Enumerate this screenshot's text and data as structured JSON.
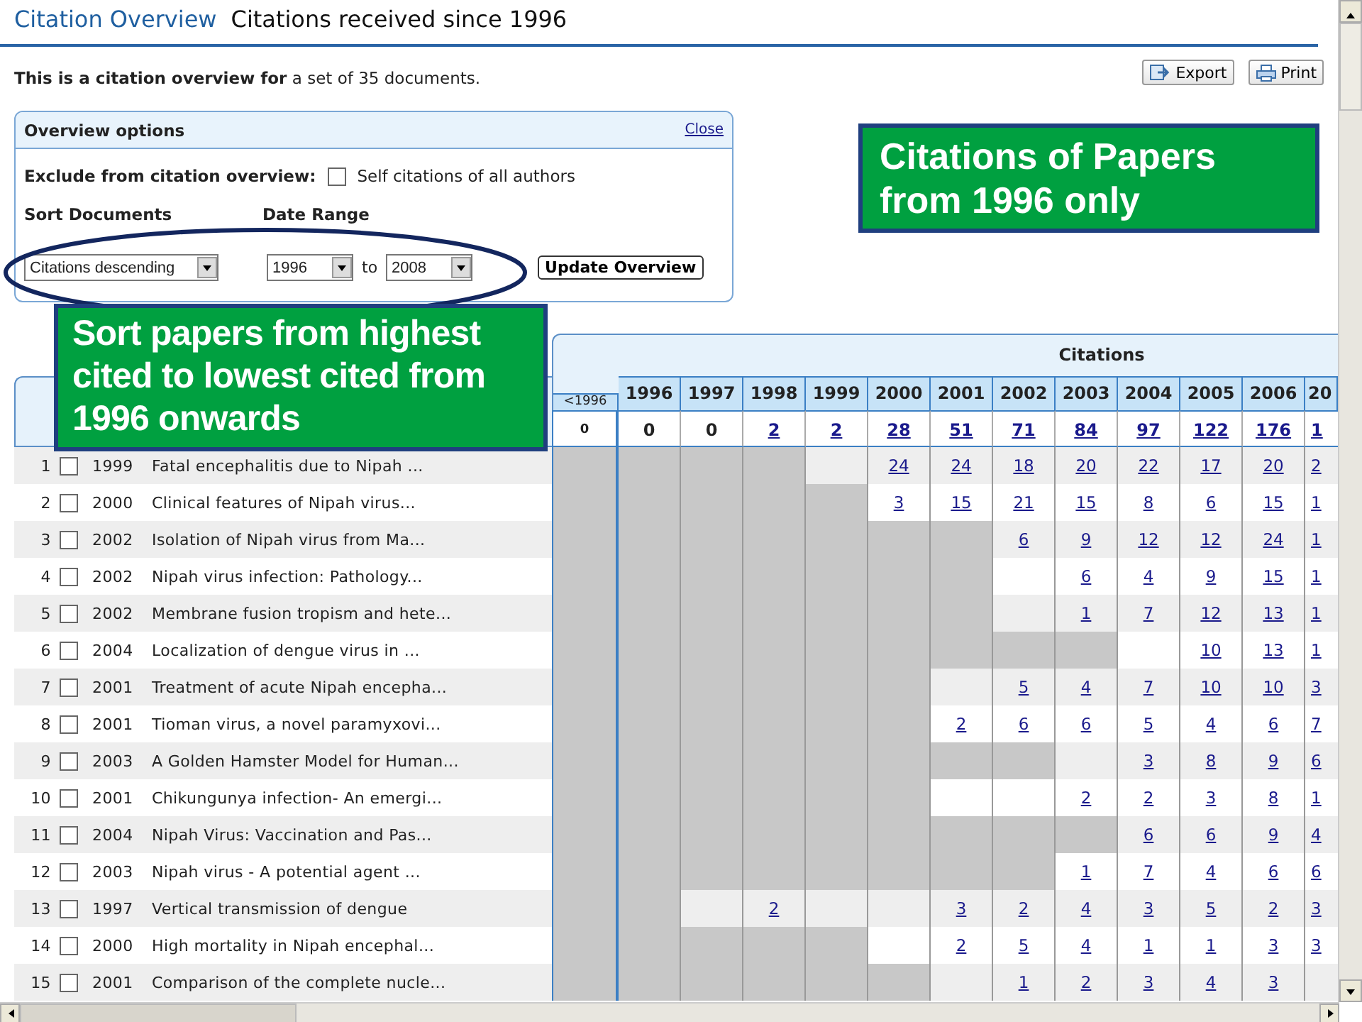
{
  "header": {
    "title": "Citation Overview",
    "subtitle": "Citations received since 1996"
  },
  "summary": "**This is a citation overview for** a set of 35 documents.",
  "toolbar": [
    {
      "label": "Export",
      "kind": "export"
    },
    {
      "label": "Print",
      "kind": "print"
    }
  ],
  "options": {
    "title": "Overview options",
    "close": "Close",
    "exclude_label": "Exclude from citation overview:",
    "self_citations": {
      "label": "Self citations of all authors",
      "checked": false
    },
    "sort_label": "Sort Documents",
    "date_label": "Date Range",
    "sort": {
      "value": "Citations descending"
    },
    "from": {
      "value": "1996"
    },
    "to_label": "to",
    "to": {
      "value": "2008"
    },
    "update_button": "Update Overview"
  },
  "callouts": [
    {
      "text": "Citations of Papers from 1996 only"
    },
    {
      "text": "Sort papers from highest cited to lowest cited from 1996 onwards"
    }
  ],
  "table": {
    "group_heading": "Citations",
    "columns": [
      "<1996",
      "1996",
      "1997",
      "1998",
      "1999",
      "2000",
      "2001",
      "2002",
      "2003",
      "2004",
      "2005",
      "2006",
      "20"
    ],
    "totals": [
      {
        "value": "0",
        "link": false
      },
      {
        "value": "0",
        "link": false
      },
      {
        "value": "0",
        "link": false
      },
      {
        "value": "2",
        "link": true
      },
      {
        "value": "2",
        "link": true
      },
      {
        "value": "28",
        "link": true
      },
      {
        "value": "51",
        "link": true
      },
      {
        "value": "71",
        "link": true
      },
      {
        "value": "84",
        "link": true
      },
      {
        "value": "97",
        "link": true
      },
      {
        "value": "122",
        "link": true
      },
      {
        "value": "176",
        "link": true
      },
      {
        "value": "1",
        "link": true
      }
    ],
    "rows": [
      {
        "number": "1",
        "checked": false,
        "year": "1999",
        "title": "Fatal encephalitis due to Nipah ...",
        "cells": [
          {
            "shaded": true
          },
          {
            "shaded": true
          },
          {
            "shaded": true
          },
          {
            "shaded": true
          },
          {
            "shaded": false
          },
          {
            "shaded": false,
            "value": "24"
          },
          {
            "shaded": false,
            "value": "24"
          },
          {
            "shaded": false,
            "value": "18"
          },
          {
            "shaded": false,
            "value": "20"
          },
          {
            "shaded": false,
            "value": "22"
          },
          {
            "shaded": false,
            "value": "17"
          },
          {
            "shaded": false,
            "value": "20"
          },
          {
            "shaded": false,
            "value": "2"
          }
        ]
      },
      {
        "number": "2",
        "checked": false,
        "year": "2000",
        "title": "Clinical features of Nipah virus...",
        "cells": [
          {
            "shaded": true
          },
          {
            "shaded": true
          },
          {
            "shaded": true
          },
          {
            "shaded": true
          },
          {
            "shaded": true
          },
          {
            "shaded": false,
            "value": "3"
          },
          {
            "shaded": false,
            "value": "15"
          },
          {
            "shaded": false,
            "value": "21"
          },
          {
            "shaded": false,
            "value": "15"
          },
          {
            "shaded": false,
            "value": "8"
          },
          {
            "shaded": false,
            "value": "6"
          },
          {
            "shaded": false,
            "value": "15"
          },
          {
            "shaded": false,
            "value": "1"
          }
        ]
      },
      {
        "number": "3",
        "checked": false,
        "year": "2002",
        "title": "Isolation of Nipah virus from Ma...",
        "cells": [
          {
            "shaded": true
          },
          {
            "shaded": true
          },
          {
            "shaded": true
          },
          {
            "shaded": true
          },
          {
            "shaded": true
          },
          {
            "shaded": true
          },
          {
            "shaded": true
          },
          {
            "shaded": false,
            "value": "6"
          },
          {
            "shaded": false,
            "value": "9"
          },
          {
            "shaded": false,
            "value": "12"
          },
          {
            "shaded": false,
            "value": "12"
          },
          {
            "shaded": false,
            "value": "24"
          },
          {
            "shaded": false,
            "value": "1"
          }
        ]
      },
      {
        "number": "4",
        "checked": false,
        "year": "2002",
        "title": "Nipah virus infection: Pathology...",
        "cells": [
          {
            "shaded": true
          },
          {
            "shaded": true
          },
          {
            "shaded": true
          },
          {
            "shaded": true
          },
          {
            "shaded": true
          },
          {
            "shaded": true
          },
          {
            "shaded": true
          },
          {
            "shaded": false
          },
          {
            "shaded": false,
            "value": "6"
          },
          {
            "shaded": false,
            "value": "4"
          },
          {
            "shaded": false,
            "value": "9"
          },
          {
            "shaded": false,
            "value": "15"
          },
          {
            "shaded": false,
            "value": "1"
          }
        ]
      },
      {
        "number": "5",
        "checked": false,
        "year": "2002",
        "title": "Membrane fusion tropism and hete...",
        "cells": [
          {
            "shaded": true
          },
          {
            "shaded": true
          },
          {
            "shaded": true
          },
          {
            "shaded": true
          },
          {
            "shaded": true
          },
          {
            "shaded": true
          },
          {
            "shaded": true
          },
          {
            "shaded": false
          },
          {
            "shaded": false,
            "value": "1"
          },
          {
            "shaded": false,
            "value": "7"
          },
          {
            "shaded": false,
            "value": "12"
          },
          {
            "shaded": false,
            "value": "13"
          },
          {
            "shaded": false,
            "value": "1"
          }
        ]
      },
      {
        "number": "6",
        "checked": false,
        "year": "2004",
        "title": "Localization of dengue virus in ...",
        "cells": [
          {
            "shaded": true
          },
          {
            "shaded": true
          },
          {
            "shaded": true
          },
          {
            "shaded": true
          },
          {
            "shaded": true
          },
          {
            "shaded": true
          },
          {
            "shaded": true
          },
          {
            "shaded": true
          },
          {
            "shaded": true
          },
          {
            "shaded": false
          },
          {
            "shaded": false,
            "value": "10"
          },
          {
            "shaded": false,
            "value": "13"
          },
          {
            "shaded": false,
            "value": "1"
          }
        ]
      },
      {
        "number": "7",
        "checked": false,
        "year": "2001",
        "title": "Treatment of acute Nipah encepha...",
        "cells": [
          {
            "shaded": true
          },
          {
            "shaded": true
          },
          {
            "shaded": true
          },
          {
            "shaded": true
          },
          {
            "shaded": true
          },
          {
            "shaded": true
          },
          {
            "shaded": false
          },
          {
            "shaded": false,
            "value": "5"
          },
          {
            "shaded": false,
            "value": "4"
          },
          {
            "shaded": false,
            "value": "7"
          },
          {
            "shaded": false,
            "value": "10"
          },
          {
            "shaded": false,
            "value": "10"
          },
          {
            "shaded": false,
            "value": "3"
          }
        ]
      },
      {
        "number": "8",
        "checked": false,
        "year": "2001",
        "title": "Tioman virus, a novel paramyxovi...",
        "cells": [
          {
            "shaded": true
          },
          {
            "shaded": true
          },
          {
            "shaded": true
          },
          {
            "shaded": true
          },
          {
            "shaded": true
          },
          {
            "shaded": true
          },
          {
            "shaded": false,
            "value": "2"
          },
          {
            "shaded": false,
            "value": "6"
          },
          {
            "shaded": false,
            "value": "6"
          },
          {
            "shaded": false,
            "value": "5"
          },
          {
            "shaded": false,
            "value": "4"
          },
          {
            "shaded": false,
            "value": "6"
          },
          {
            "shaded": false,
            "value": "7"
          }
        ]
      },
      {
        "number": "9",
        "checked": false,
        "year": "2003",
        "title": "A Golden Hamster Model for Human...",
        "cells": [
          {
            "shaded": true
          },
          {
            "shaded": true
          },
          {
            "shaded": true
          },
          {
            "shaded": true
          },
          {
            "shaded": true
          },
          {
            "shaded": true
          },
          {
            "shaded": true
          },
          {
            "shaded": true
          },
          {
            "shaded": false
          },
          {
            "shaded": false,
            "value": "3"
          },
          {
            "shaded": false,
            "value": "8"
          },
          {
            "shaded": false,
            "value": "9"
          },
          {
            "shaded": false,
            "value": "6"
          }
        ]
      },
      {
        "number": "10",
        "checked": false,
        "year": "2001",
        "title": "Chikungunya infection- An emergi...",
        "cells": [
          {
            "shaded": true
          },
          {
            "shaded": true
          },
          {
            "shaded": true
          },
          {
            "shaded": true
          },
          {
            "shaded": true
          },
          {
            "shaded": true
          },
          {
            "shaded": false
          },
          {
            "shaded": false
          },
          {
            "shaded": false,
            "value": "2"
          },
          {
            "shaded": false,
            "value": "2"
          },
          {
            "shaded": false,
            "value": "3"
          },
          {
            "shaded": false,
            "value": "8"
          },
          {
            "shaded": false,
            "value": "1"
          }
        ]
      },
      {
        "number": "11",
        "checked": false,
        "year": "2004",
        "title": "Nipah Virus: Vaccination and Pas...",
        "cells": [
          {
            "shaded": true
          },
          {
            "shaded": true
          },
          {
            "shaded": true
          },
          {
            "shaded": true
          },
          {
            "shaded": true
          },
          {
            "shaded": true
          },
          {
            "shaded": true
          },
          {
            "shaded": true
          },
          {
            "shaded": true
          },
          {
            "shaded": false,
            "value": "6"
          },
          {
            "shaded": false,
            "value": "6"
          },
          {
            "shaded": false,
            "value": "9"
          },
          {
            "shaded": false,
            "value": "4"
          }
        ]
      },
      {
        "number": "12",
        "checked": false,
        "year": "2003",
        "title": "Nipah virus - A potential agent ...",
        "cells": [
          {
            "shaded": true
          },
          {
            "shaded": true
          },
          {
            "shaded": true
          },
          {
            "shaded": true
          },
          {
            "shaded": true
          },
          {
            "shaded": true
          },
          {
            "shaded": true
          },
          {
            "shaded": true
          },
          {
            "shaded": false,
            "value": "1"
          },
          {
            "shaded": false,
            "value": "7"
          },
          {
            "shaded": false,
            "value": "4"
          },
          {
            "shaded": false,
            "value": "6"
          },
          {
            "shaded": false,
            "value": "6"
          }
        ]
      },
      {
        "number": "13",
        "checked": false,
        "year": "1997",
        "title": "Vertical transmission of dengue",
        "cells": [
          {
            "shaded": true
          },
          {
            "shaded": true
          },
          {
            "shaded": false
          },
          {
            "shaded": false,
            "value": "2"
          },
          {
            "shaded": false
          },
          {
            "shaded": false
          },
          {
            "shaded": false,
            "value": "3"
          },
          {
            "shaded": false,
            "value": "2"
          },
          {
            "shaded": false,
            "value": "4"
          },
          {
            "shaded": false,
            "value": "3"
          },
          {
            "shaded": false,
            "value": "5"
          },
          {
            "shaded": false,
            "value": "2"
          },
          {
            "shaded": false,
            "value": "3"
          }
        ]
      },
      {
        "number": "14",
        "checked": false,
        "year": "2000",
        "title": "High mortality in Nipah encephal...",
        "cells": [
          {
            "shaded": true
          },
          {
            "shaded": true
          },
          {
            "shaded": true
          },
          {
            "shaded": true
          },
          {
            "shaded": true
          },
          {
            "shaded": false
          },
          {
            "shaded": false,
            "value": "2"
          },
          {
            "shaded": false,
            "value": "5"
          },
          {
            "shaded": false,
            "value": "4"
          },
          {
            "shaded": false,
            "value": "1"
          },
          {
            "shaded": false,
            "value": "1"
          },
          {
            "shaded": false,
            "value": "3"
          },
          {
            "shaded": false,
            "value": "3"
          }
        ]
      },
      {
        "number": "15",
        "checked": false,
        "year": "2001",
        "title": "Comparison of the complete nucle...",
        "cells": [
          {
            "shaded": true
          },
          {
            "shaded": true
          },
          {
            "shaded": true
          },
          {
            "shaded": true
          },
          {
            "shaded": true
          },
          {
            "shaded": true
          },
          {
            "shaded": false
          },
          {
            "shaded": false,
            "value": "1"
          },
          {
            "shaded": false,
            "value": "2"
          },
          {
            "shaded": false,
            "value": "3"
          },
          {
            "shaded": false,
            "value": "4"
          },
          {
            "shaded": false,
            "value": "3"
          },
          {
            "shaded": false
          }
        ]
      }
    ]
  }
}
